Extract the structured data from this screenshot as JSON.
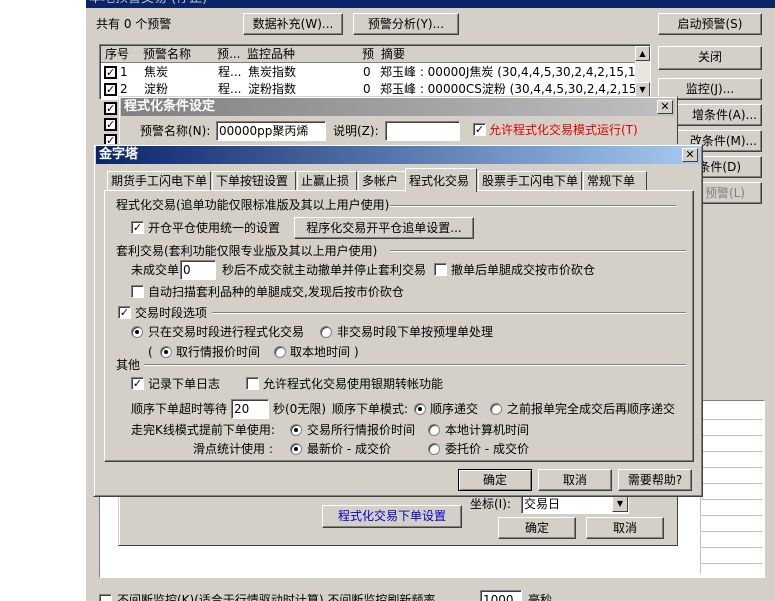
{
  "main": {
    "title": "本地预警交易   (停止)",
    "count_label": "共有 0 个预警",
    "btn_data": "数据补充(W)...",
    "btn_analysis": "预警分析(Y)...",
    "btn_start": "启动预警(S)",
    "btn_close": "关闭",
    "btn_monitor": "监控(J)...",
    "btn_add": "增条件(A)...",
    "btn_modify": "改条件(M)...",
    "btn_delete": "条件(D)",
    "btn_warn": "预警(L)",
    "columns": [
      "序号",
      "预警名称",
      "预...",
      "监控品种",
      "预",
      "摘要"
    ],
    "rows": [
      {
        "no": "1",
        "name": "焦炭",
        "pre": "程...",
        "variety": "焦炭指数",
        "p": "0",
        "summary": "郑玉峰 : 00000J焦炭 (30,4,4,5,30,2,4,2,15,1"
      },
      {
        "no": "2",
        "name": "淀粉",
        "pre": "程...",
        "variety": "淀粉指数",
        "p": "0",
        "summary": "郑玉峰 : 00000CS淀粉 (30,4,4,5,30,2,4,2,15,1"
      }
    ],
    "bottom_text": "不间断监控(K)(适合于行情驱动时计算)  不间断监控刷新频率",
    "bottom_value": "1000",
    "bottom_unit": "毫秒"
  },
  "cond": {
    "title": "程式化条件设定",
    "name_label": "预警名称(N):",
    "name_value": "00000pp聚丙烯",
    "desc_label": "说明(Z):",
    "allow_label": "允许程式化交易模式运行(T)",
    "coord_label": "坐标(I):",
    "coord_value": "交易日",
    "btn_prog": "程式化交易下单设置",
    "btn_ok": "确定",
    "btn_cancel": "取消"
  },
  "dialog": {
    "title": "金字塔",
    "tabs": [
      "期货手工闪电下单",
      "下单按钮设置",
      "止赢止损",
      "多帐户",
      "程式化交易",
      "股票手工闪电下单",
      "常规下单"
    ],
    "active_tab": 4,
    "sec1": "程式化交易(追单功能仅限标准版及其以上用户使用)",
    "open_close_label": "开仓平仓使用统一的设置",
    "btn_chase": "程序化交易开平仓追单设置...",
    "sec2": "套利交易(套利功能仅限专业版及其以上用户使用)",
    "unfilled_label": "未成交单",
    "unfilled_value": "0",
    "unfilled_suffix": "秒后不成交就主动撤单并停止套利交易",
    "cancel_chase_label": "撤单后单腿成交按市价砍仓",
    "auto_scan_label": "自动扫描套利品种的单腿成交,发现后按市价砍仓",
    "session_label": "交易时段选项",
    "only_session_label": "只在交易时段进行程式化交易",
    "non_session_label": "非交易时段下单按预埋单处理",
    "quote_time_label": "取行情报价时间",
    "local_time_label": "取本地时间",
    "sec_other": "其他",
    "log_label": "记录下单日志",
    "bank_label": "允许程式化交易使用银期转帐功能",
    "timeout_label": "顺序下单超时等待",
    "timeout_value": "20",
    "timeout_suffix": "秒(0无限)",
    "order_mode_label": "顺序下单模式:",
    "seq_label": "顺序递交",
    "prev_label": "之前报单完全成交后再顺序递交",
    "kline_label": "走完K线模式提前下单使用:",
    "exch_time_label": "交易所行情报价时间",
    "local_pc_label": "本地计算机时间",
    "slip_label": "滑点统计使用 :",
    "latest_label": "最新价 - 成交价",
    "order_price_label": "委托价 - 成交价",
    "btn_ok": "确定",
    "btn_cancel": "取消",
    "btn_help": "需要帮助?"
  }
}
